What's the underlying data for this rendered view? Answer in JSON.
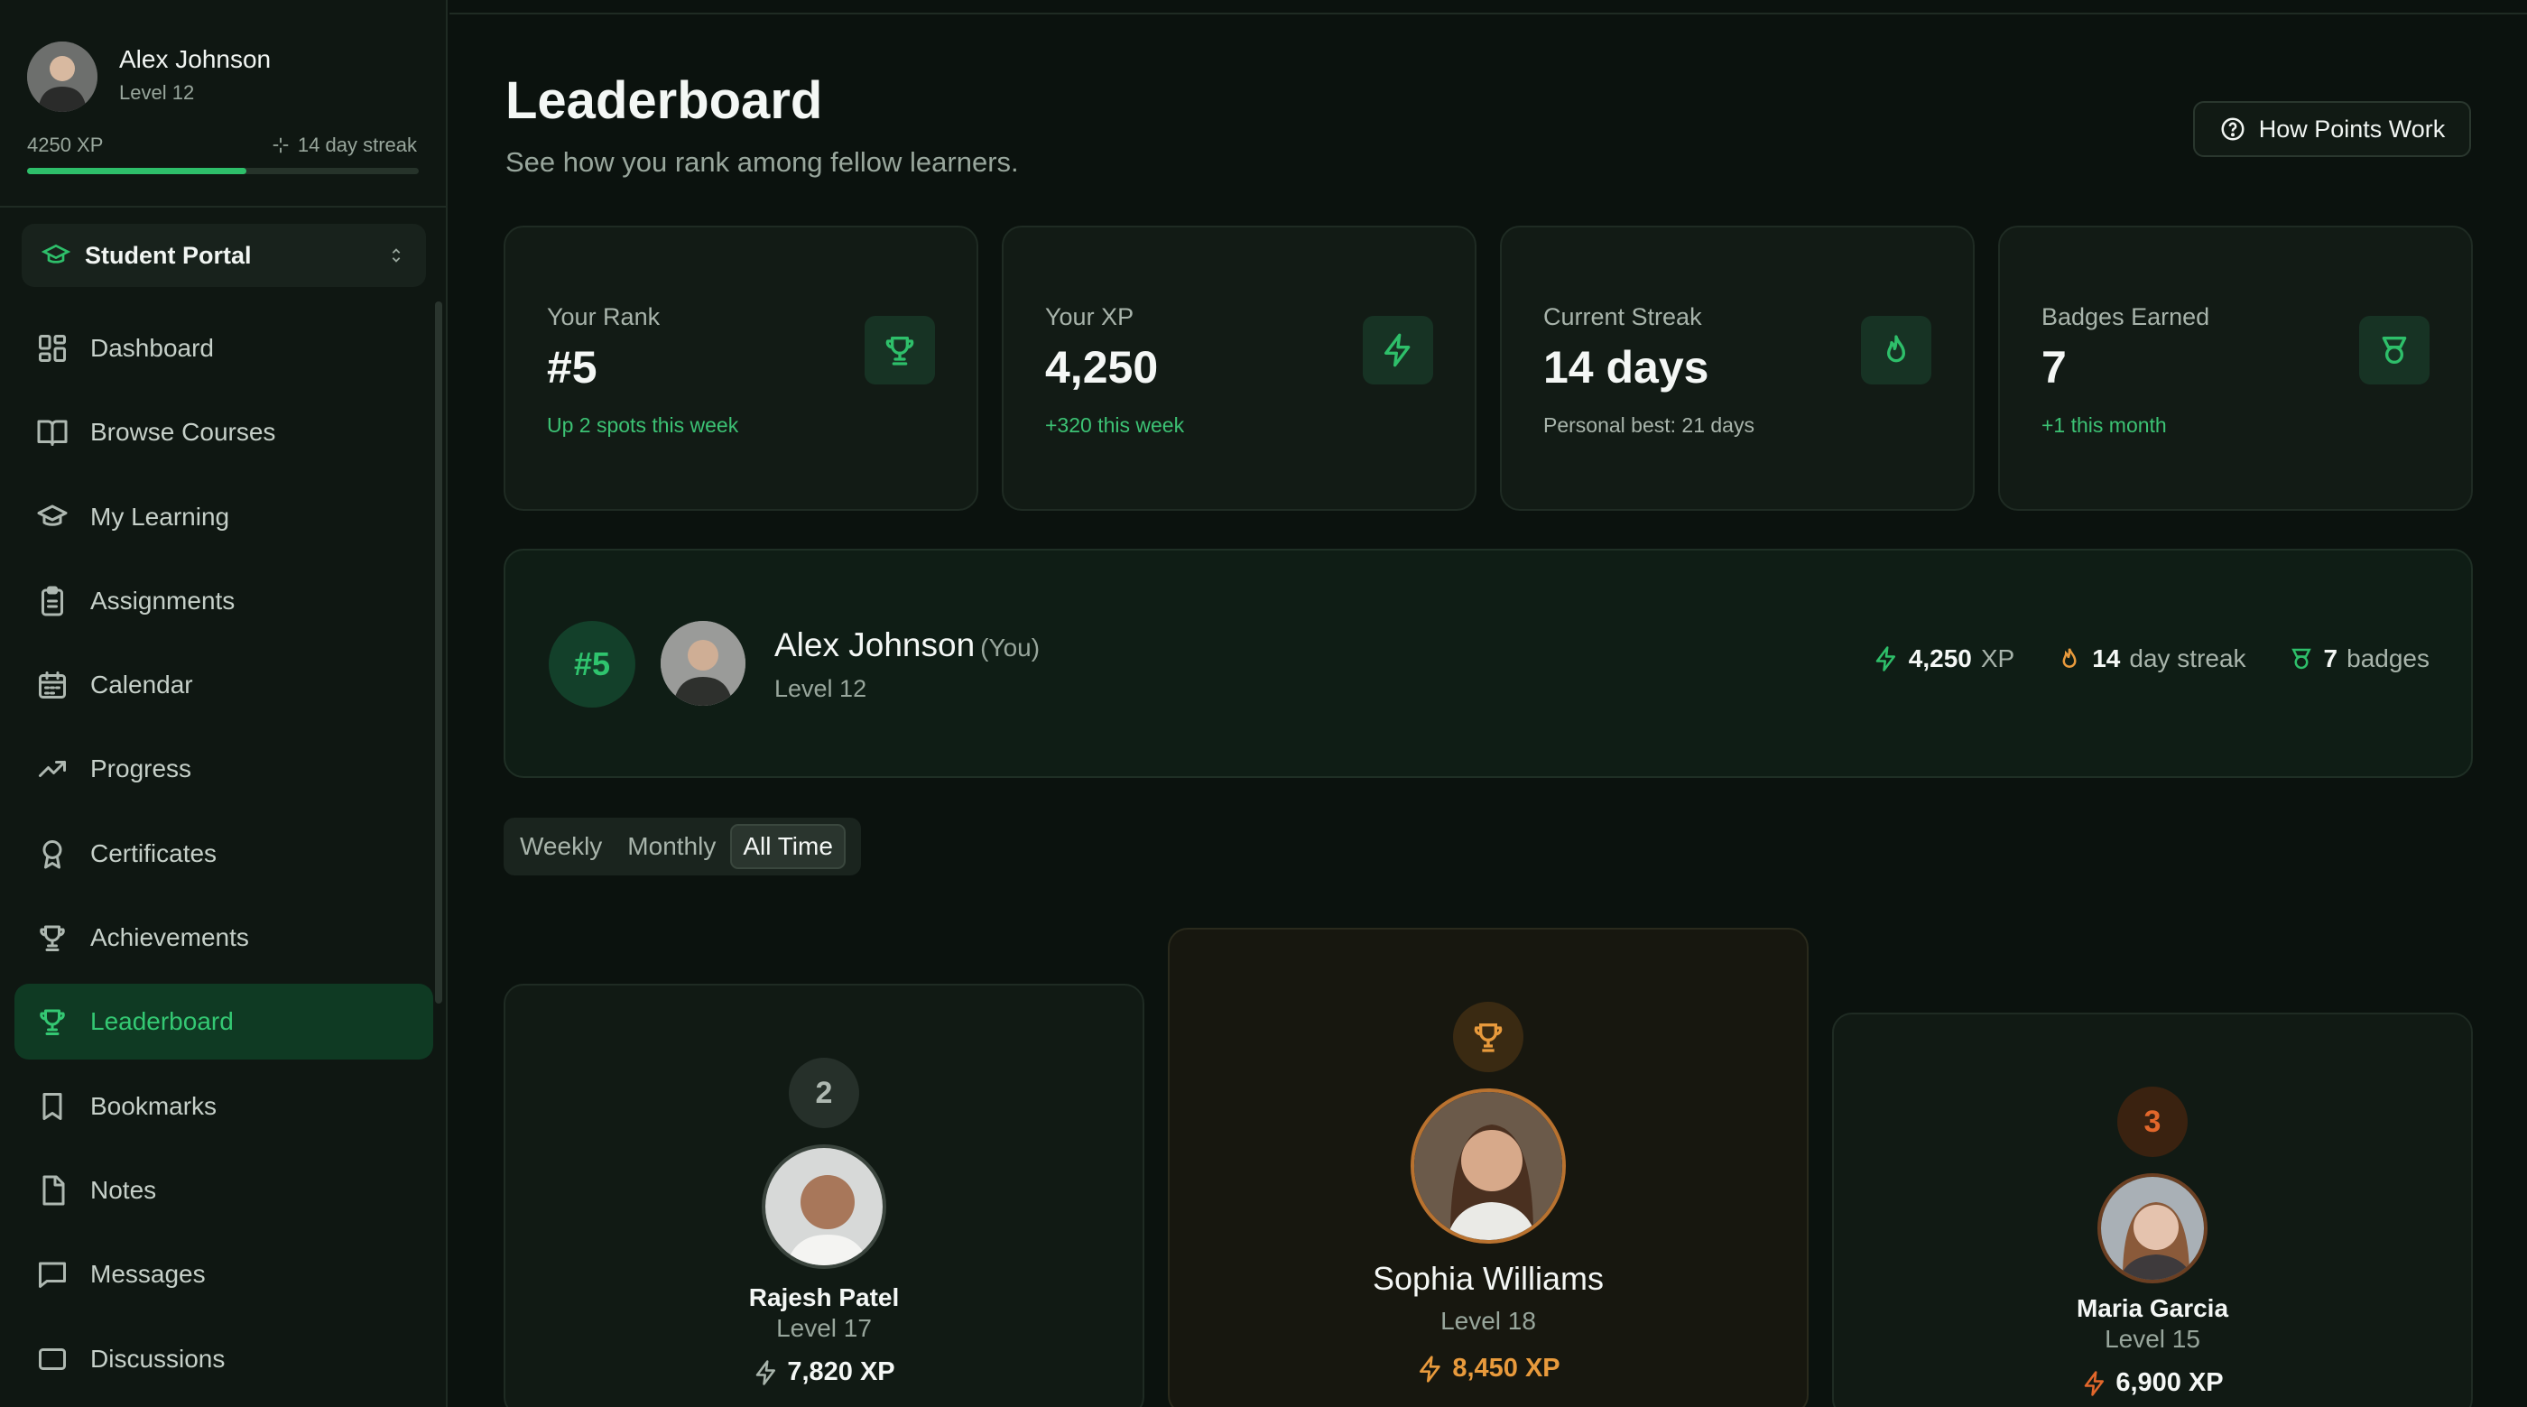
{
  "user": {
    "name": "Alex Johnson",
    "level": "Level 12",
    "xp": "4250 XP",
    "streak": "14 day streak",
    "xp_progress": 0.56
  },
  "portal": {
    "label": "Student Portal"
  },
  "nav": [
    {
      "label": "Dashboard",
      "icon": "dashboard-icon"
    },
    {
      "label": "Browse Courses",
      "icon": "book-icon"
    },
    {
      "label": "My Learning",
      "icon": "graduation-cap-icon"
    },
    {
      "label": "Assignments",
      "icon": "clipboard-icon"
    },
    {
      "label": "Calendar",
      "icon": "calendar-icon"
    },
    {
      "label": "Progress",
      "icon": "trending-up-icon"
    },
    {
      "label": "Certificates",
      "icon": "award-icon"
    },
    {
      "label": "Achievements",
      "icon": "trophy-icon"
    },
    {
      "label": "Leaderboard",
      "icon": "trophy-icon",
      "active": true
    },
    {
      "label": "Bookmarks",
      "icon": "bookmark-icon"
    },
    {
      "label": "Notes",
      "icon": "note-icon"
    },
    {
      "label": "Messages",
      "icon": "message-icon"
    },
    {
      "label": "Discussions",
      "icon": "discussion-icon"
    }
  ],
  "header": {
    "title": "Leaderboard",
    "subtitle": "See how you rank among fellow learners.",
    "how_button": "How Points Work"
  },
  "stats": [
    {
      "label": "Your Rank",
      "value": "#5",
      "sub": "Up 2 spots this week",
      "icon": "trophy-icon"
    },
    {
      "label": "Your XP",
      "value": "4,250",
      "sub": "+320 this week",
      "icon": "lightning-icon"
    },
    {
      "label": "Current Streak",
      "value": "14 days",
      "sub": "Personal best: 21 days",
      "icon": "flame-icon"
    },
    {
      "label": "Badges Earned",
      "value": "7",
      "sub": "+1 this month",
      "icon": "badge-icon"
    }
  ],
  "you": {
    "rank": "#5",
    "name": "Alex Johnson",
    "tag": "(You)",
    "level": "Level 12",
    "xp_value": "4,250",
    "xp_unit": "XP",
    "streak_value": "14",
    "streak_unit": "day streak",
    "badges_value": "7",
    "badges_unit": "badges"
  },
  "tabs": [
    "Weekly",
    "Monthly",
    "All Time"
  ],
  "active_tab": "All Time",
  "podium": [
    {
      "rank": "2",
      "name": "Rajesh Patel",
      "level": "Level 17",
      "xp": "7,820 XP"
    },
    {
      "name": "Sophia Williams",
      "level": "Level 18",
      "xp": "8,450 XP"
    },
    {
      "rank": "3",
      "name": "Maria Garcia",
      "level": "Level 15",
      "xp": "6,900 XP"
    }
  ],
  "colors": {
    "accent": "#2ebf6a",
    "gold": "#e89a3c",
    "bronze": "#e2672b",
    "background": "#0b120e"
  }
}
